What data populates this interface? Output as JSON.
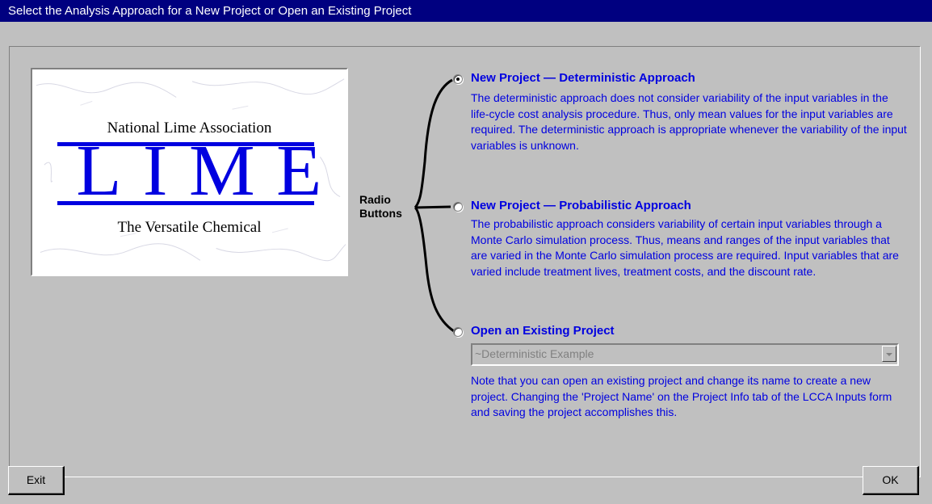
{
  "window": {
    "title": "Select the Analysis Approach for a New Project or Open an Existing Project"
  },
  "logo": {
    "organization": "National Lime Association",
    "word": "LIME",
    "tagline": "The Versatile Chemical",
    "color": "#0000e0"
  },
  "callout": {
    "line1": "Radio",
    "line2": "Buttons"
  },
  "options": [
    {
      "title": "New Project — Deterministic Approach",
      "selected": true,
      "description": "The deterministic approach does not consider variability of the input variables in the life-cycle cost analysis procedure.  Thus, only mean values for the input variables are required.  The deterministic approach is appropriate whenever the variability of the input variables is unknown."
    },
    {
      "title": "New Project — Probabilistic Approach",
      "selected": false,
      "description": "The probabilistic approach considers variability of certain input variables through a Monte Carlo simulation process.  Thus, means and ranges of the input variables that are varied in the Monte Carlo simulation process are required.  Input variables that are varied include treatment lives, treatment costs, and the discount rate."
    },
    {
      "title": "Open an Existing Project",
      "selected": false,
      "combo_value": "~Deterministic Example",
      "description": "Note that you can open an existing project and change its name to create a new project.  Changing the 'Project Name' on the Project Info tab of the LCCA Inputs form and saving the project accomplishes this."
    }
  ],
  "buttons": {
    "exit": "Exit",
    "ok": "OK"
  },
  "colors": {
    "title_bar": "#000080",
    "accent_text": "#0000e0",
    "face": "#c0c0c0"
  }
}
